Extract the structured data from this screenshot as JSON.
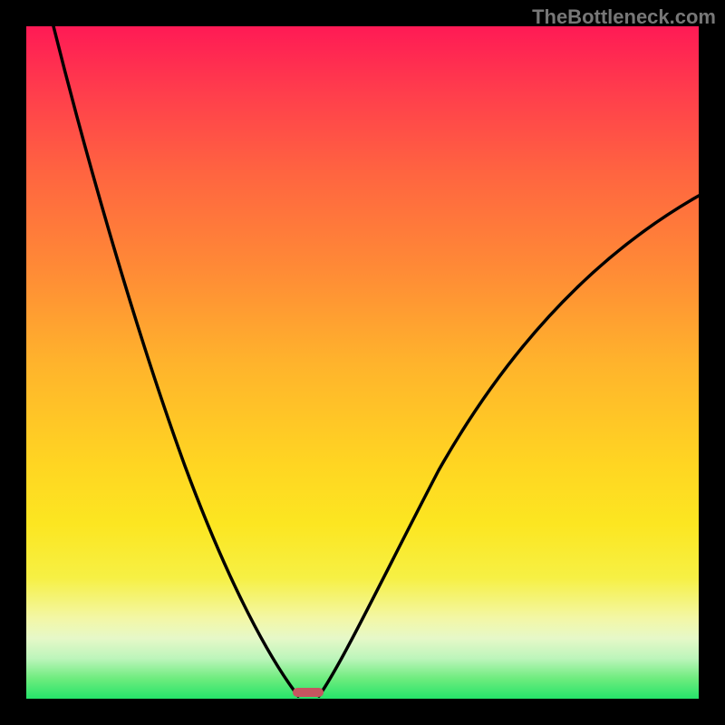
{
  "watermark": "TheBottleneck.com",
  "chart_data": {
    "type": "line",
    "title": "",
    "xlabel": "",
    "ylabel": "",
    "x_range": [
      0,
      100
    ],
    "y_range": [
      0,
      100
    ],
    "series": [
      {
        "name": "left-curve",
        "points": [
          {
            "x": 4,
            "y": 100
          },
          {
            "x": 8,
            "y": 89
          },
          {
            "x": 12,
            "y": 78
          },
          {
            "x": 16,
            "y": 67
          },
          {
            "x": 20,
            "y": 56
          },
          {
            "x": 24,
            "y": 45
          },
          {
            "x": 28,
            "y": 34
          },
          {
            "x": 32,
            "y": 23
          },
          {
            "x": 36,
            "y": 12
          },
          {
            "x": 39.5,
            "y": 2
          },
          {
            "x": 40.5,
            "y": 0
          }
        ]
      },
      {
        "name": "right-curve",
        "points": [
          {
            "x": 43.5,
            "y": 0
          },
          {
            "x": 45,
            "y": 2
          },
          {
            "x": 48,
            "y": 8
          },
          {
            "x": 52,
            "y": 17
          },
          {
            "x": 56,
            "y": 25
          },
          {
            "x": 60,
            "y": 33
          },
          {
            "x": 66,
            "y": 43
          },
          {
            "x": 72,
            "y": 51
          },
          {
            "x": 80,
            "y": 60
          },
          {
            "x": 88,
            "y": 67
          },
          {
            "x": 96,
            "y": 73
          },
          {
            "x": 100,
            "y": 75
          }
        ]
      }
    ],
    "marker": {
      "x_center": 42,
      "width_percent": 4.5,
      "color": "#c65560"
    },
    "gradient": {
      "top": "#ff1a55",
      "mid_orange": "#ff8a36",
      "mid_yellow": "#ffd522",
      "bottom": "#25e36a"
    },
    "background": "#000000"
  }
}
